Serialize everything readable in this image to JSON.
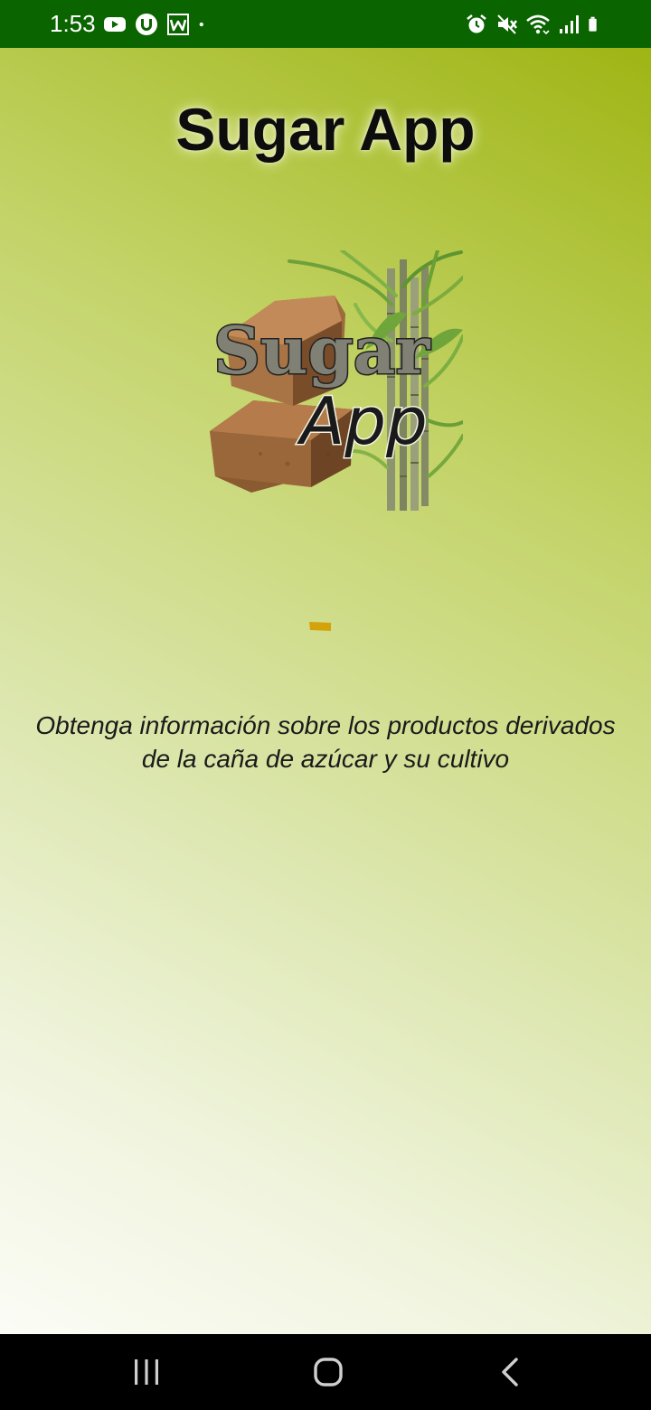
{
  "status_bar": {
    "time": "1:53",
    "background_color": "#0a6400",
    "left_icons": [
      "youtube-icon",
      "u-app-icon",
      "word-icon",
      "notification-dot-icon"
    ],
    "right_icons": [
      "alarm-icon",
      "mute-icon",
      "wifi-icon",
      "signal-icon",
      "battery-icon"
    ]
  },
  "screen": {
    "title": "Sugar App",
    "logo": {
      "word1": "Sugar",
      "word2": "App"
    },
    "tagline": {
      "line1": "Obtenga información sobre los productos derivados",
      "line2": "de la caña de azúcar y su cultivo"
    },
    "colors": {
      "gradient_top": "#9fb514",
      "gradient_bottom": "#fbfcf6",
      "loader": "#d4a20a"
    }
  },
  "nav_bar": {
    "buttons": [
      "recent-apps-icon",
      "home-icon",
      "back-icon"
    ]
  }
}
